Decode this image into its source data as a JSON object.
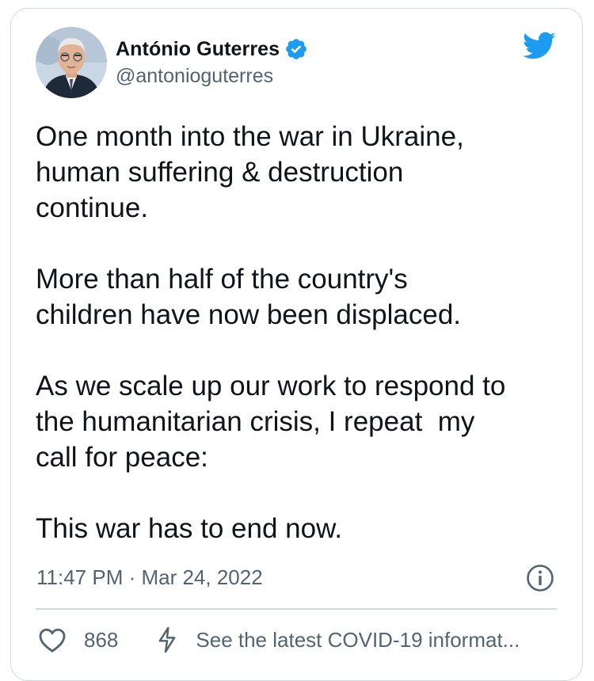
{
  "tweet": {
    "author": {
      "display_name": "António Guterres",
      "handle": "@antonioguterres",
      "verified_icon": "verified-badge-icon"
    },
    "paragraphs": [
      "One month into the war in Ukraine,\nhuman suffering & destruction\ncontinue.",
      "More than half of the country's\nchildren have now been displaced.",
      "As we scale up our work to respond to\nthe humanitarian crisis, I repeat  my\ncall for peace:",
      "This war has to end now."
    ],
    "timestamp": "11:47 PM · Mar 24, 2022",
    "like_count": "868",
    "covid_notice": "See the latest COVID-19 informat..."
  },
  "colors": {
    "brand": "#1d9bf0",
    "text_primary": "#0f1419",
    "text_secondary": "#536471",
    "border": "#cfd9de"
  },
  "icons": [
    "twitter-bird-icon",
    "verified-badge-icon",
    "info-icon",
    "heart-icon",
    "bolt-icon"
  ]
}
